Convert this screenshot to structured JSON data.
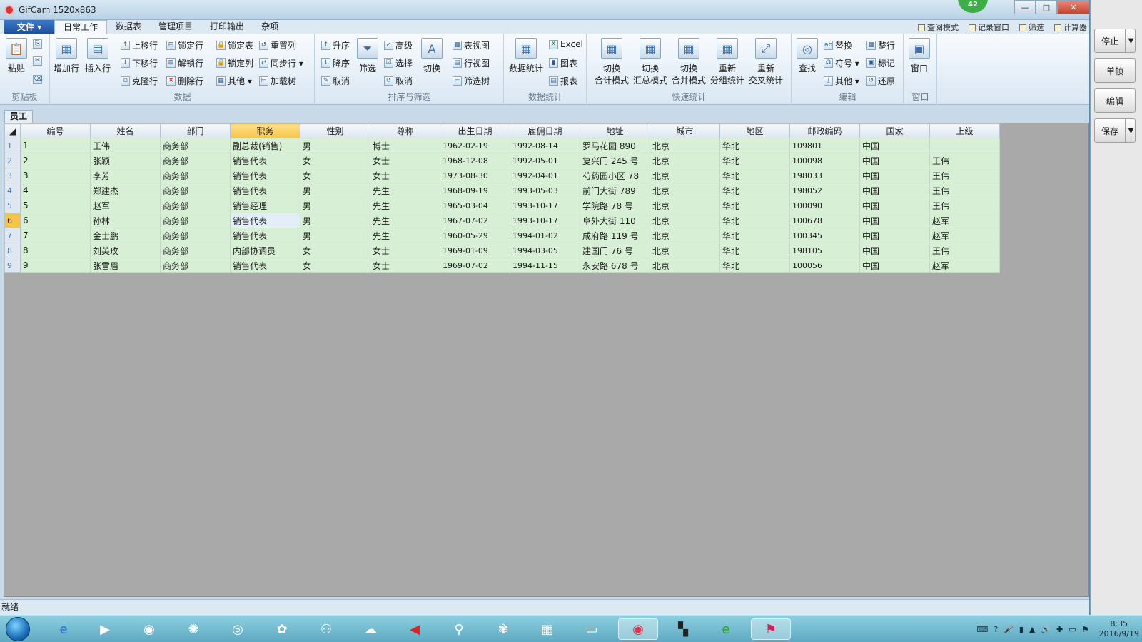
{
  "window": {
    "title": "GifCam 1520x863"
  },
  "badge": "42",
  "menu": {
    "file": "文件",
    "tabs": [
      "日常工作",
      "数据表",
      "管理项目",
      "打印输出",
      "杂项"
    ],
    "quick": [
      "查阅模式",
      "记录窗口",
      "筛选",
      "计算器"
    ]
  },
  "ribbon": {
    "clipboard": {
      "title": "剪贴板",
      "paste": "粘贴"
    },
    "data": {
      "title": "数据",
      "add_row": "增加行",
      "insert_row": "插入行",
      "move_up": "上移行",
      "move_down": "下移行",
      "clone_row": "克隆行",
      "lock_row": "锁定行",
      "unlock_row": "解锁行",
      "delete_row": "删除行",
      "lock_table": "锁定表",
      "lock_col": "锁定列",
      "other": "其他",
      "reset_col": "重置列",
      "sync_row": "同步行",
      "load_tree": "加载树"
    },
    "sort": {
      "title": "排序与筛选",
      "asc": "升序",
      "desc": "降序",
      "cancel": "取消",
      "filter": "筛选",
      "advanced": "高级",
      "select": "选择",
      "cancel2": "取消",
      "toggle": "切换"
    },
    "view": {
      "table_view": "表视图",
      "row_view": "行视图",
      "filter_tree": "筛选树"
    },
    "stats": {
      "title": "数据统计",
      "data_stats": "数据统计",
      "excel": "Excel",
      "chart": "图表",
      "report": "报表"
    },
    "quickstats": {
      "title": "快速统计",
      "b1": "切换\n合计模式",
      "b1a": "切换",
      "b1b": "合计模式",
      "b2a": "切换",
      "b2b": "汇总模式",
      "b3a": "切换",
      "b3b": "合并模式",
      "b4a": "重新",
      "b4b": "分组统计",
      "b5a": "重新",
      "b5b": "交叉统计"
    },
    "edit": {
      "title": "编辑",
      "find": "查找",
      "replace": "替换",
      "symbol": "符号",
      "other": "其他",
      "tidy": "整行",
      "mark": "标记",
      "restore": "还原"
    },
    "window": {
      "title": "窗口",
      "window": "窗口"
    }
  },
  "sheet_tab": "员工",
  "table": {
    "columns": [
      "编号",
      "姓名",
      "部门",
      "职务",
      "性别",
      "尊称",
      "出生日期",
      "雇佣日期",
      "地址",
      "城市",
      "地区",
      "邮政编码",
      "国家",
      "上级"
    ],
    "rows": [
      [
        "1",
        "王伟",
        "商务部",
        "副总裁(销售)",
        "男",
        "博士",
        "1962-02-19",
        "1992-08-14",
        "罗马花园 890",
        "北京",
        "华北",
        "109801",
        "中国",
        ""
      ],
      [
        "2",
        "张颖",
        "商务部",
        "销售代表",
        "女",
        "女士",
        "1968-12-08",
        "1992-05-01",
        "复兴门 245 号",
        "北京",
        "华北",
        "100098",
        "中国",
        "王伟"
      ],
      [
        "3",
        "李芳",
        "商务部",
        "销售代表",
        "女",
        "女士",
        "1973-08-30",
        "1992-04-01",
        "芍药园小区 78",
        "北京",
        "华北",
        "198033",
        "中国",
        "王伟"
      ],
      [
        "4",
        "郑建杰",
        "商务部",
        "销售代表",
        "男",
        "先生",
        "1968-09-19",
        "1993-05-03",
        "前门大街 789",
        "北京",
        "华北",
        "198052",
        "中国",
        "王伟"
      ],
      [
        "5",
        "赵军",
        "商务部",
        "销售经理",
        "男",
        "先生",
        "1965-03-04",
        "1993-10-17",
        "学院路 78 号",
        "北京",
        "华北",
        "100090",
        "中国",
        "王伟"
      ],
      [
        "6",
        "孙林",
        "商务部",
        "销售代表",
        "男",
        "先生",
        "1967-07-02",
        "1993-10-17",
        "阜外大街 110",
        "北京",
        "华北",
        "100678",
        "中国",
        "赵军"
      ],
      [
        "7",
        "金士鹏",
        "商务部",
        "销售代表",
        "男",
        "先生",
        "1960-05-29",
        "1994-01-02",
        "成府路 119 号",
        "北京",
        "华北",
        "100345",
        "中国",
        "赵军"
      ],
      [
        "8",
        "刘英玫",
        "商务部",
        "内部协调员",
        "女",
        "女士",
        "1969-01-09",
        "1994-03-05",
        "建国门 76 号",
        "北京",
        "华北",
        "198105",
        "中国",
        "王伟"
      ],
      [
        "9",
        "张雪眉",
        "商务部",
        "销售代表",
        "女",
        "女士",
        "1969-07-02",
        "1994-11-15",
        "永安路 678 号",
        "北京",
        "华北",
        "100056",
        "中国",
        "赵军"
      ]
    ]
  },
  "status": "就绪",
  "gifcam": {
    "stop": "停止",
    "frame": "单帧",
    "edit": "编辑",
    "save": "保存"
  },
  "clock": {
    "time": "8:35",
    "date": "2016/9/19"
  }
}
